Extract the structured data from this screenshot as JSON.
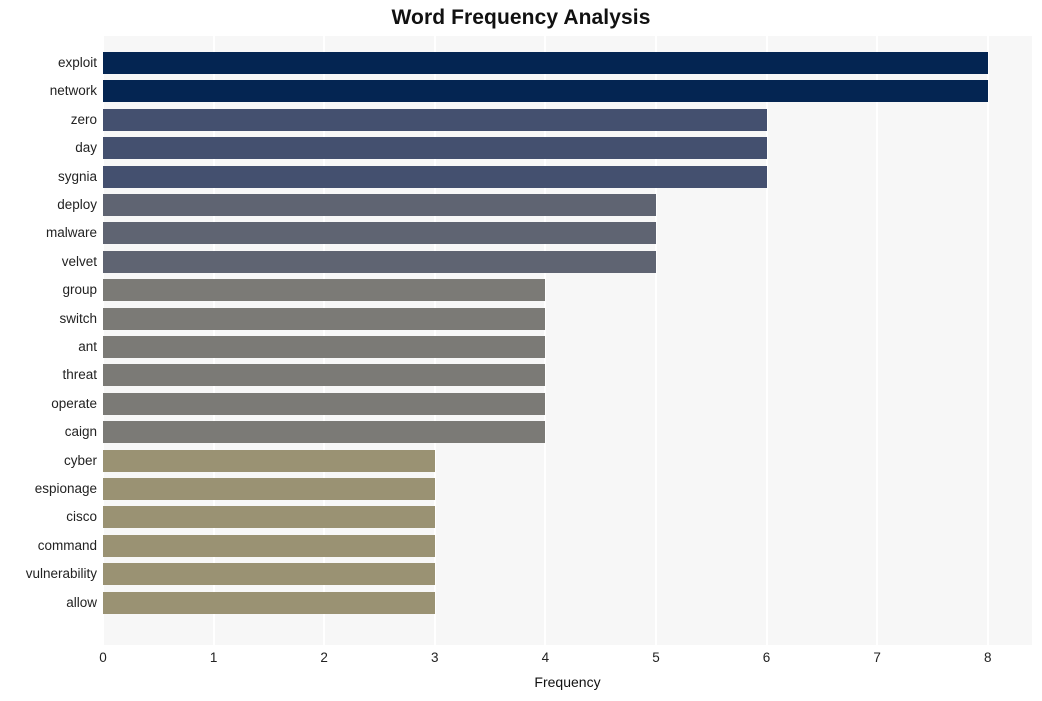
{
  "chart_data": {
    "type": "bar",
    "orientation": "horizontal",
    "title": "Word Frequency Analysis",
    "xlabel": "Frequency",
    "ylabel": "",
    "xlim": [
      0,
      8.4
    ],
    "xticks": [
      "0",
      "1",
      "2",
      "3",
      "4",
      "5",
      "6",
      "7",
      "8"
    ],
    "xtick_values": [
      0,
      1,
      2,
      3,
      4,
      5,
      6,
      7,
      8
    ],
    "grid": "vertical-white-on-gray",
    "legend": "none",
    "categories": [
      "exploit",
      "network",
      "zero",
      "day",
      "sygnia",
      "deploy",
      "malware",
      "velvet",
      "group",
      "switch",
      "ant",
      "threat",
      "operate",
      "caign",
      "cyber",
      "espionage",
      "cisco",
      "command",
      "vulnerability",
      "allow"
    ],
    "values": [
      8,
      8,
      6,
      6,
      6,
      5,
      5,
      5,
      4,
      4,
      4,
      4,
      4,
      4,
      3,
      3,
      3,
      3,
      3,
      3
    ],
    "bar_colors": [
      "#042552",
      "#042552",
      "#44506f",
      "#44506f",
      "#44506f",
      "#5f6472",
      "#5f6472",
      "#5f6472",
      "#7b7a76",
      "#7b7a76",
      "#7b7a76",
      "#7b7a76",
      "#7b7a76",
      "#7b7a76",
      "#9a9273",
      "#9a9273",
      "#9a9273",
      "#9a9273",
      "#9a9273",
      "#9a9273"
    ],
    "plot_background": "#f7f7f7",
    "figure_background": "#ffffff",
    "gridline_color": "#ffffff",
    "title_color": "#111111"
  }
}
